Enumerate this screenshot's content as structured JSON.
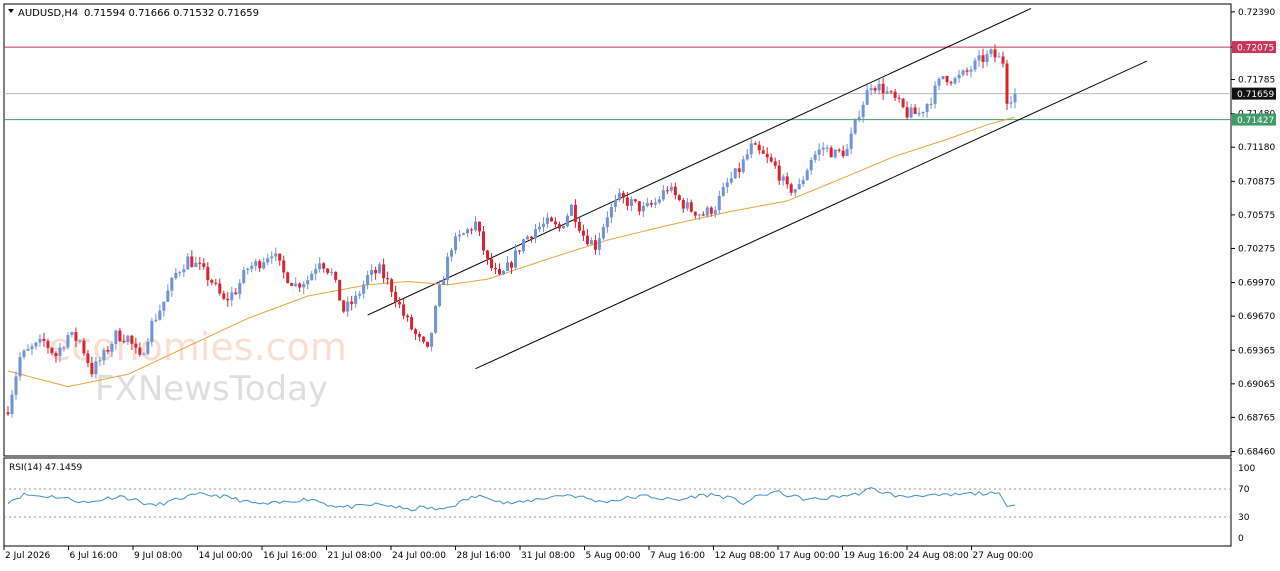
{
  "header": {
    "symbol_timeframe": "AUDUSD,H4",
    "ohlc": "0.71594 0.71666 0.71532 0.71659"
  },
  "watermark": {
    "line1": "economies.com",
    "line2": "FXNewsToday"
  },
  "colors": {
    "bull": "#6f93d6",
    "bear": "#d9232e",
    "ma": "#e8a43c",
    "resistance": "#c8355a",
    "support": "#3f9b67",
    "current": "#111111",
    "rsi": "#3d8fd1",
    "grid_level": "#999999"
  },
  "chart_data": {
    "type": "candlestick",
    "y_ticks": [
      "0.72390",
      "0.72075",
      "0.71785",
      "0.71480",
      "0.71180",
      "0.70875",
      "0.70575",
      "0.70275",
      "0.69970",
      "0.69670",
      "0.69365",
      "0.69065",
      "0.68765",
      "0.68460"
    ],
    "ylim": [
      0.6842,
      0.7246
    ],
    "x_ticks": [
      "2 Jul 2026",
      "6 Jul 16:00",
      "9 Jul 08:00",
      "14 Jul 00:00",
      "16 Jul 16:00",
      "21 Jul 08:00",
      "24 Jul 00:00",
      "28 Jul 16:00",
      "31 Jul 08:00",
      "5 Aug 00:00",
      "7 Aug 16:00",
      "12 Aug 08:00",
      "17 Aug 00:00",
      "19 Aug 16:00",
      "24 Aug 08:00",
      "27 Aug 00:00"
    ],
    "last_price": {
      "value": 0.71659,
      "label": "0.71659"
    },
    "resistance": {
      "value": 0.72075,
      "label": "0.72075"
    },
    "support": {
      "value": 0.71427,
      "label": "0.71427"
    },
    "close_path": [
      [
        0,
        0.6885
      ],
      [
        3,
        0.693
      ],
      [
        6,
        0.6938
      ],
      [
        9,
        0.6944
      ],
      [
        12,
        0.6932
      ],
      [
        15,
        0.695
      ],
      [
        18,
        0.6945
      ],
      [
        21,
        0.6918
      ],
      [
        24,
        0.6932
      ],
      [
        27,
        0.695
      ],
      [
        30,
        0.6948
      ],
      [
        33,
        0.6928
      ],
      [
        36,
        0.696
      ],
      [
        39,
        0.698
      ],
      [
        42,
        0.7005
      ],
      [
        45,
        0.7018
      ],
      [
        48,
        0.701
      ],
      [
        51,
        0.6998
      ],
      [
        54,
        0.698
      ],
      [
        57,
        0.699
      ],
      [
        60,
        0.701
      ],
      [
        63,
        0.7015
      ],
      [
        66,
        0.7025
      ],
      [
        69,
        0.7005
      ],
      [
        72,
        0.6995
      ],
      [
        75,
        0.7
      ],
      [
        78,
        0.7018
      ],
      [
        81,
        0.7005
      ],
      [
        84,
        0.6972
      ],
      [
        87,
        0.6982
      ],
      [
        90,
        0.7002
      ],
      [
        93,
        0.7008
      ],
      [
        96,
        0.6992
      ],
      [
        99,
        0.6968
      ],
      [
        102,
        0.695
      ],
      [
        105,
        0.6935
      ],
      [
        108,
        0.699
      ],
      [
        111,
        0.703
      ],
      [
        114,
        0.704
      ],
      [
        117,
        0.705
      ],
      [
        120,
        0.7015
      ],
      [
        123,
        0.7
      ],
      [
        126,
        0.7015
      ],
      [
        129,
        0.7035
      ],
      [
        132,
        0.7045
      ],
      [
        135,
        0.705
      ],
      [
        138,
        0.7045
      ],
      [
        141,
        0.7065
      ],
      [
        144,
        0.704
      ],
      [
        147,
        0.703
      ],
      [
        150,
        0.7058
      ],
      [
        153,
        0.7072
      ],
      [
        156,
        0.7068
      ],
      [
        159,
        0.7062
      ],
      [
        162,
        0.7068
      ],
      [
        165,
        0.7082
      ],
      [
        168,
        0.707
      ],
      [
        171,
        0.7062
      ],
      [
        174,
        0.7058
      ],
      [
        177,
        0.7065
      ],
      [
        180,
        0.7085
      ],
      [
        183,
        0.7098
      ],
      [
        186,
        0.7118
      ],
      [
        189,
        0.711
      ],
      [
        192,
        0.71
      ],
      [
        195,
        0.708
      ],
      [
        198,
        0.7082
      ],
      [
        201,
        0.7108
      ],
      [
        204,
        0.7118
      ],
      [
        207,
        0.7112
      ],
      [
        210,
        0.7115
      ],
      [
        213,
        0.715
      ],
      [
        216,
        0.7175
      ],
      [
        219,
        0.717
      ],
      [
        222,
        0.716
      ],
      [
        225,
        0.7148
      ],
      [
        228,
        0.7148
      ],
      [
        231,
        0.7162
      ],
      [
        234,
        0.7182
      ],
      [
        237,
        0.7178
      ],
      [
        240,
        0.7185
      ],
      [
        243,
        0.7195
      ],
      [
        246,
        0.7201
      ],
      [
        249,
        0.7195
      ],
      [
        250,
        0.7162
      ],
      [
        252,
        0.7165
      ]
    ],
    "ma_path": [
      [
        0,
        0.6918
      ],
      [
        15,
        0.6904
      ],
      [
        30,
        0.6915
      ],
      [
        45,
        0.694
      ],
      [
        60,
        0.6965
      ],
      [
        75,
        0.6985
      ],
      [
        90,
        0.6995
      ],
      [
        100,
        0.6998
      ],
      [
        110,
        0.6995
      ],
      [
        120,
        0.7
      ],
      [
        135,
        0.7018
      ],
      [
        150,
        0.7035
      ],
      [
        165,
        0.7048
      ],
      [
        180,
        0.706
      ],
      [
        195,
        0.707
      ],
      [
        210,
        0.7092
      ],
      [
        222,
        0.711
      ],
      [
        235,
        0.7125
      ],
      [
        245,
        0.7138
      ],
      [
        252,
        0.7145
      ]
    ],
    "channel_upper": [
      [
        90,
        0.6968
      ],
      [
        256,
        0.7242
      ]
    ],
    "channel_lower": [
      [
        117,
        0.692
      ],
      [
        285,
        0.7195
      ]
    ],
    "rsi": {
      "label": "RSI(14) 47.1459",
      "levels": [
        70,
        30
      ],
      "scale": [
        "100",
        "70",
        "30",
        "0"
      ],
      "path": [
        [
          0,
          52
        ],
        [
          4,
          62
        ],
        [
          8,
          60
        ],
        [
          12,
          59
        ],
        [
          16,
          55
        ],
        [
          20,
          50
        ],
        [
          24,
          56
        ],
        [
          28,
          60
        ],
        [
          32,
          54
        ],
        [
          36,
          46
        ],
        [
          40,
          51
        ],
        [
          44,
          58
        ],
        [
          48,
          62
        ],
        [
          52,
          61
        ],
        [
          56,
          57
        ],
        [
          60,
          51
        ],
        [
          64,
          48
        ],
        [
          68,
          50
        ],
        [
          72,
          54
        ],
        [
          76,
          56
        ],
        [
          80,
          48
        ],
        [
          84,
          44
        ],
        [
          88,
          45
        ],
        [
          92,
          48
        ],
        [
          96,
          46
        ],
        [
          100,
          40
        ],
        [
          104,
          44
        ],
        [
          108,
          40
        ],
        [
          112,
          48
        ],
        [
          116,
          58
        ],
        [
          120,
          60
        ],
        [
          124,
          50
        ],
        [
          128,
          50
        ],
        [
          132,
          55
        ],
        [
          136,
          59
        ],
        [
          140,
          62
        ],
        [
          144,
          58
        ],
        [
          148,
          52
        ],
        [
          152,
          54
        ],
        [
          156,
          58
        ],
        [
          160,
          60
        ],
        [
          164,
          56
        ],
        [
          168,
          54
        ],
        [
          172,
          60
        ],
        [
          176,
          62
        ],
        [
          180,
          58
        ],
        [
          184,
          50
        ],
        [
          188,
          60
        ],
        [
          192,
          66
        ],
        [
          196,
          60
        ],
        [
          200,
          55
        ],
        [
          204,
          56
        ],
        [
          208,
          60
        ],
        [
          212,
          62
        ],
        [
          216,
          70
        ],
        [
          220,
          64
        ],
        [
          224,
          58
        ],
        [
          228,
          62
        ],
        [
          232,
          60
        ],
        [
          236,
          61
        ],
        [
          240,
          63
        ],
        [
          244,
          64
        ],
        [
          248,
          62
        ],
        [
          250,
          45
        ],
        [
          252,
          47
        ]
      ]
    }
  }
}
